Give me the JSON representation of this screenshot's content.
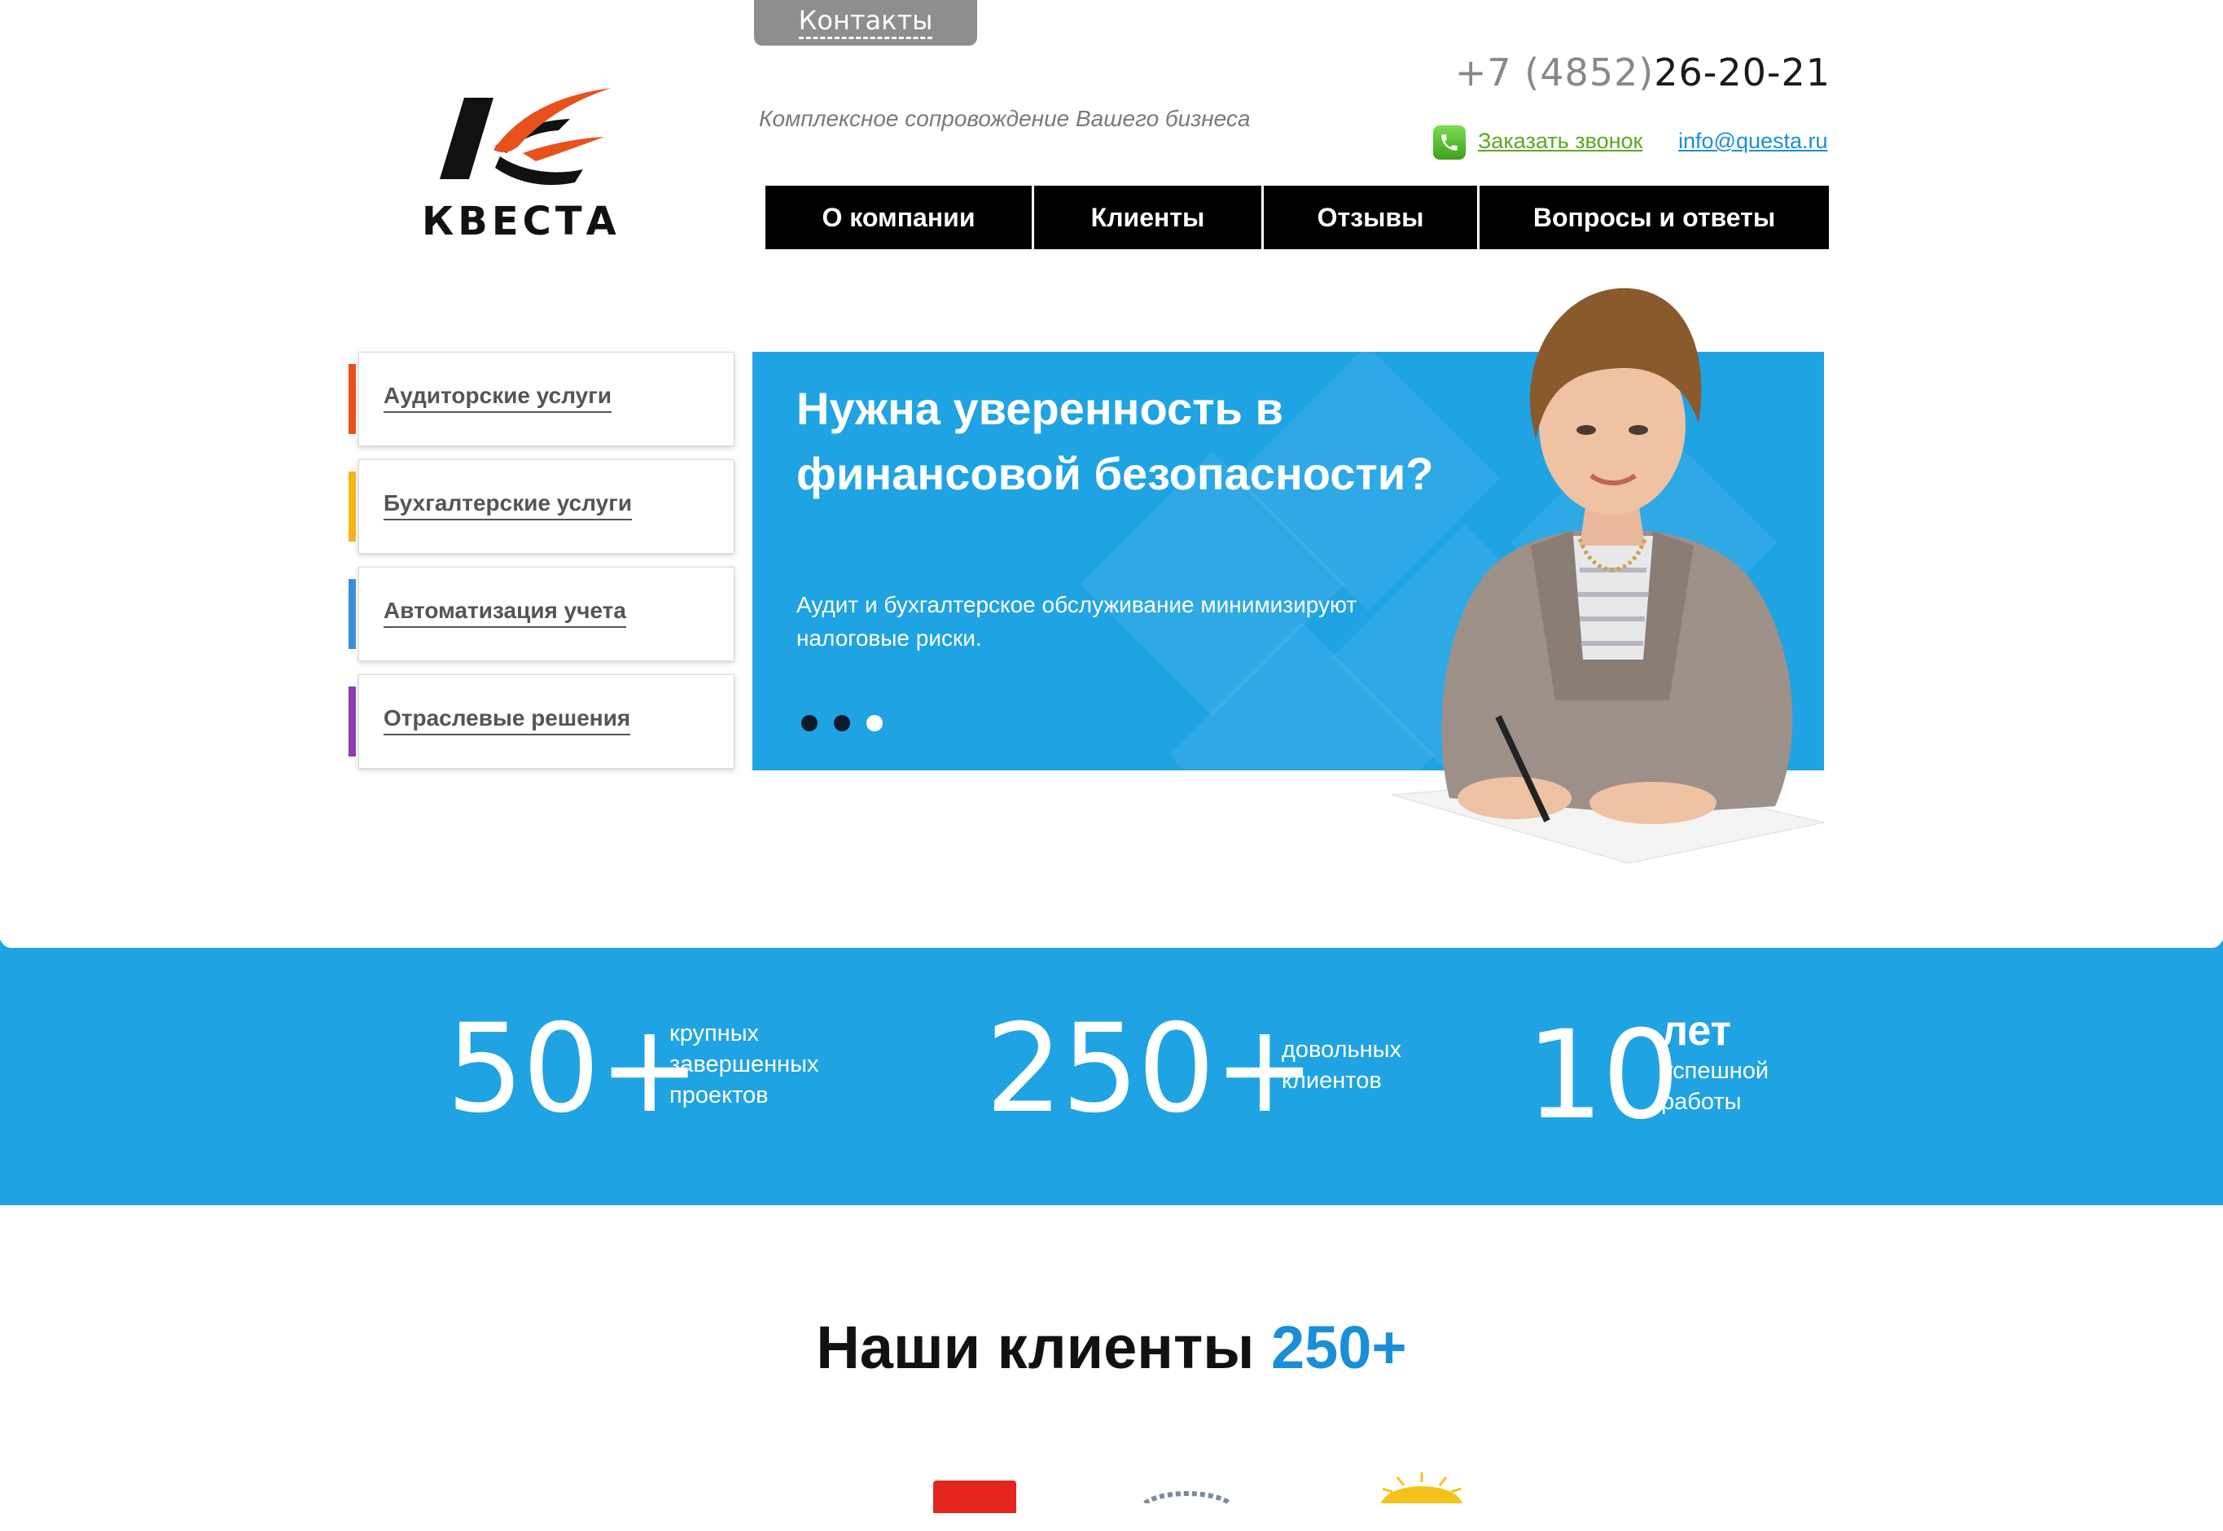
{
  "header": {
    "contacts_tab": "Контакты",
    "logo_text": "КВЕСТА",
    "tagline": "Комплексное сопровождение Вашего бизнеса",
    "phone_prefix": "+7 (4852)",
    "phone_number": "26-20-21",
    "callback_label": "Заказать звонок",
    "callback_icon": "phone-icon",
    "email": "info@questa.ru"
  },
  "nav": {
    "items": [
      {
        "label": "О компании"
      },
      {
        "label": "Клиенты"
      },
      {
        "label": "Отзывы"
      },
      {
        "label": "Вопросы и ответы"
      }
    ]
  },
  "services": {
    "items": [
      {
        "label": "Аудиторские услуги",
        "color": "#e8501c"
      },
      {
        "label": "Бухгалтерские услуги",
        "color": "#f5b51a"
      },
      {
        "label": "Автоматизация учета",
        "color": "#3b8fd9"
      },
      {
        "label": "Отраслевые решения",
        "color": "#8e3bb0"
      }
    ]
  },
  "banner": {
    "title": "Нужна уверенность в финансовой безопасности?",
    "text": "Аудит и бухгалтерское обслуживание минимизируют налоговые риски.",
    "slides_total": 3,
    "slides_active": 3
  },
  "stats": [
    {
      "value": "50+",
      "label_lines": [
        "крупных",
        "завершенных",
        "проектов"
      ]
    },
    {
      "value": "250+",
      "label_lines": [
        "довольных",
        "клиентов"
      ]
    },
    {
      "value": "10",
      "label_big": "лет",
      "label_lines": [
        "успешной",
        "работы"
      ]
    }
  ],
  "clients": {
    "heading": "Наши клиенты",
    "count": "250+"
  },
  "colors": {
    "brand_blue": "#1fa3e3",
    "link_blue": "#1a8fd8",
    "link_green": "#5aa820",
    "nav_bg": "#000000",
    "logo_orange": "#e8501c"
  }
}
